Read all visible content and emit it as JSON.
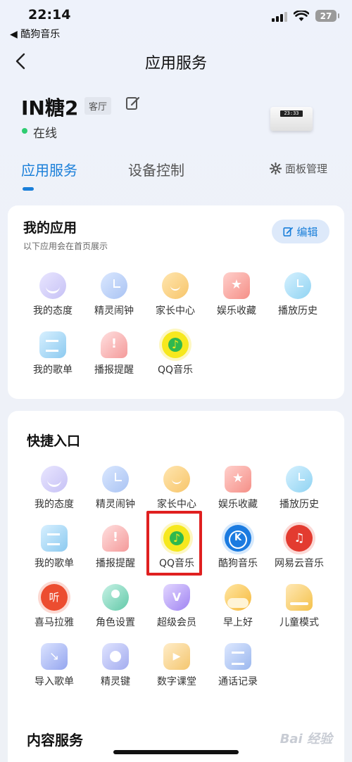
{
  "status_bar": {
    "time": "22:14",
    "back_app": "◀ 酷狗音乐",
    "battery": "27"
  },
  "nav": {
    "title": "应用服务"
  },
  "device": {
    "name": "IN糖2",
    "room": "客厅",
    "status": "在线",
    "screen_time": "23:33"
  },
  "tabs": {
    "services": "应用服务",
    "control": "设备控制",
    "panel_mgmt": "面板管理"
  },
  "my_apps": {
    "title": "我的应用",
    "subtitle": "以下应用会在首页展示",
    "edit_label": "编辑",
    "items": [
      "我的态度",
      "精灵闹钟",
      "家长中心",
      "娱乐收藏",
      "播放历史",
      "我的歌单",
      "播报提醒",
      "QQ音乐"
    ]
  },
  "quick": {
    "title": "快捷入口",
    "items": [
      "我的态度",
      "精灵闹钟",
      "家长中心",
      "娱乐收藏",
      "播放历史",
      "我的歌单",
      "播报提醒",
      "QQ音乐",
      "酷狗音乐",
      "网易云音乐",
      "喜马拉雅",
      "角色设置",
      "超级会员",
      "早上好",
      "儿童模式",
      "导入歌单",
      "精灵键",
      "数字课堂",
      "通话记录"
    ]
  },
  "content_services": {
    "title": "内容服务"
  },
  "colors": {
    "accent": "#1a7fd9",
    "online": "#2ecc71",
    "highlight": "#e02020"
  },
  "watermark": "Bai 经验"
}
